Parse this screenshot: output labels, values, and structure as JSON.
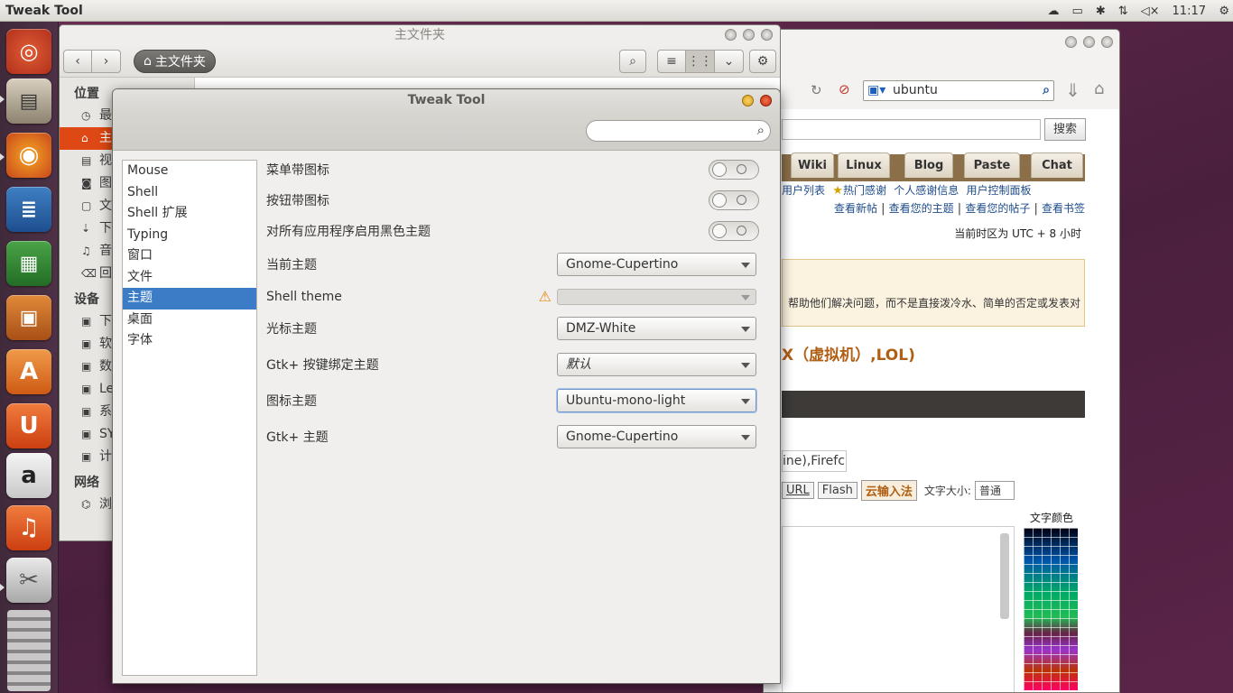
{
  "topbar": {
    "app_title": "Tweak Tool",
    "clock": "11:17",
    "icons": [
      "cloud-icon",
      "battery-icon",
      "bluetooth-icon",
      "network-icon",
      "volume-mute-icon",
      "gear-icon"
    ]
  },
  "launcher": {
    "items": [
      "ubuntu-dash",
      "files",
      "firefox",
      "libreoffice-writer",
      "libreoffice-calc",
      "libreoffice-impress",
      "ubuntu-software-center",
      "ubuntu-one",
      "amazon",
      "ubuntu-one-music",
      "tweak-tool"
    ]
  },
  "nautilus": {
    "title": "主文件夹",
    "path_button": "主文件夹",
    "sections": [
      {
        "heading": "位置",
        "items": [
          {
            "icon": "clock-icon",
            "label": "最"
          },
          {
            "icon": "home-icon",
            "label": "主",
            "selected": true
          },
          {
            "icon": "film-icon",
            "label": "视"
          },
          {
            "icon": "camera-icon",
            "label": "图"
          },
          {
            "icon": "document-icon",
            "label": "文"
          },
          {
            "icon": "download-icon",
            "label": "下"
          },
          {
            "icon": "music-icon",
            "label": "音"
          },
          {
            "icon": "trash-icon",
            "label": "回"
          }
        ]
      },
      {
        "heading": "设备",
        "items": [
          {
            "icon": "drive-icon",
            "label": "下"
          },
          {
            "icon": "drive-icon",
            "label": "软"
          },
          {
            "icon": "drive-icon",
            "label": "数"
          },
          {
            "icon": "drive-icon",
            "label": "Le"
          },
          {
            "icon": "drive-icon",
            "label": "系"
          },
          {
            "icon": "drive-icon",
            "label": "SY"
          },
          {
            "icon": "drive-icon",
            "label": "计"
          }
        ]
      },
      {
        "heading": "网络",
        "items": [
          {
            "icon": "network-icon",
            "label": "浏"
          }
        ]
      }
    ]
  },
  "firefox": {
    "search_value": "ubuntu",
    "search_button": "搜索",
    "tabs": [
      "Wiki",
      "Linux",
      "Blog",
      "Paste",
      "Chat"
    ],
    "links_row1": [
      "用户列表",
      "热门感谢",
      "个人感谢信息",
      "用户控制面板"
    ],
    "links_row2": [
      "查看新帖",
      "查看您的主题",
      "查看您的帖子",
      "查看书签"
    ],
    "timezone": "当前时区为 UTC + 8 小时",
    "notice": "帮助他们解决问题，而不是直接泼冷水、简单的否定或发表对",
    "heading": "X（虚拟机）,LOL)",
    "input_text": "ine),Firefc",
    "toolbar_buttons": [
      "URL",
      "Flash",
      "云输入法"
    ],
    "font_size_label": "文字大小:",
    "font_size_value": "普通",
    "color_label": "文字颜色"
  },
  "tweak": {
    "title": "Tweak Tool",
    "search_placeholder": "",
    "categories": [
      {
        "label": "Mouse"
      },
      {
        "label": "Shell"
      },
      {
        "label": "Shell 扩展"
      },
      {
        "label": "Typing"
      },
      {
        "label": "窗口"
      },
      {
        "label": "文件"
      },
      {
        "label": "主题",
        "selected": true
      },
      {
        "label": "桌面"
      },
      {
        "label": "字体"
      }
    ],
    "switches": [
      {
        "label": "菜单带图标",
        "state": "off"
      },
      {
        "label": "按钮带图标",
        "state": "off"
      },
      {
        "label": "对所有应用程序启用黑色主题",
        "state": "off"
      }
    ],
    "combos": [
      {
        "label": "当前主题",
        "value": "Gnome-Cupertino"
      },
      {
        "label": "Shell theme",
        "value": "",
        "disabled": true,
        "warning": true
      },
      {
        "label": "光标主题",
        "value": "DMZ-White"
      },
      {
        "label": "Gtk+ 按键绑定主题",
        "value": "默认"
      },
      {
        "label": "图标主题",
        "value": "Ubuntu-mono-light",
        "focused": true
      },
      {
        "label": "Gtk+ 主题",
        "value": "Gnome-Cupertino"
      }
    ]
  },
  "colors": {
    "accent_orange": "#dd4814",
    "selection_blue": "#3c7bc6",
    "panel": "#dcdad5"
  }
}
